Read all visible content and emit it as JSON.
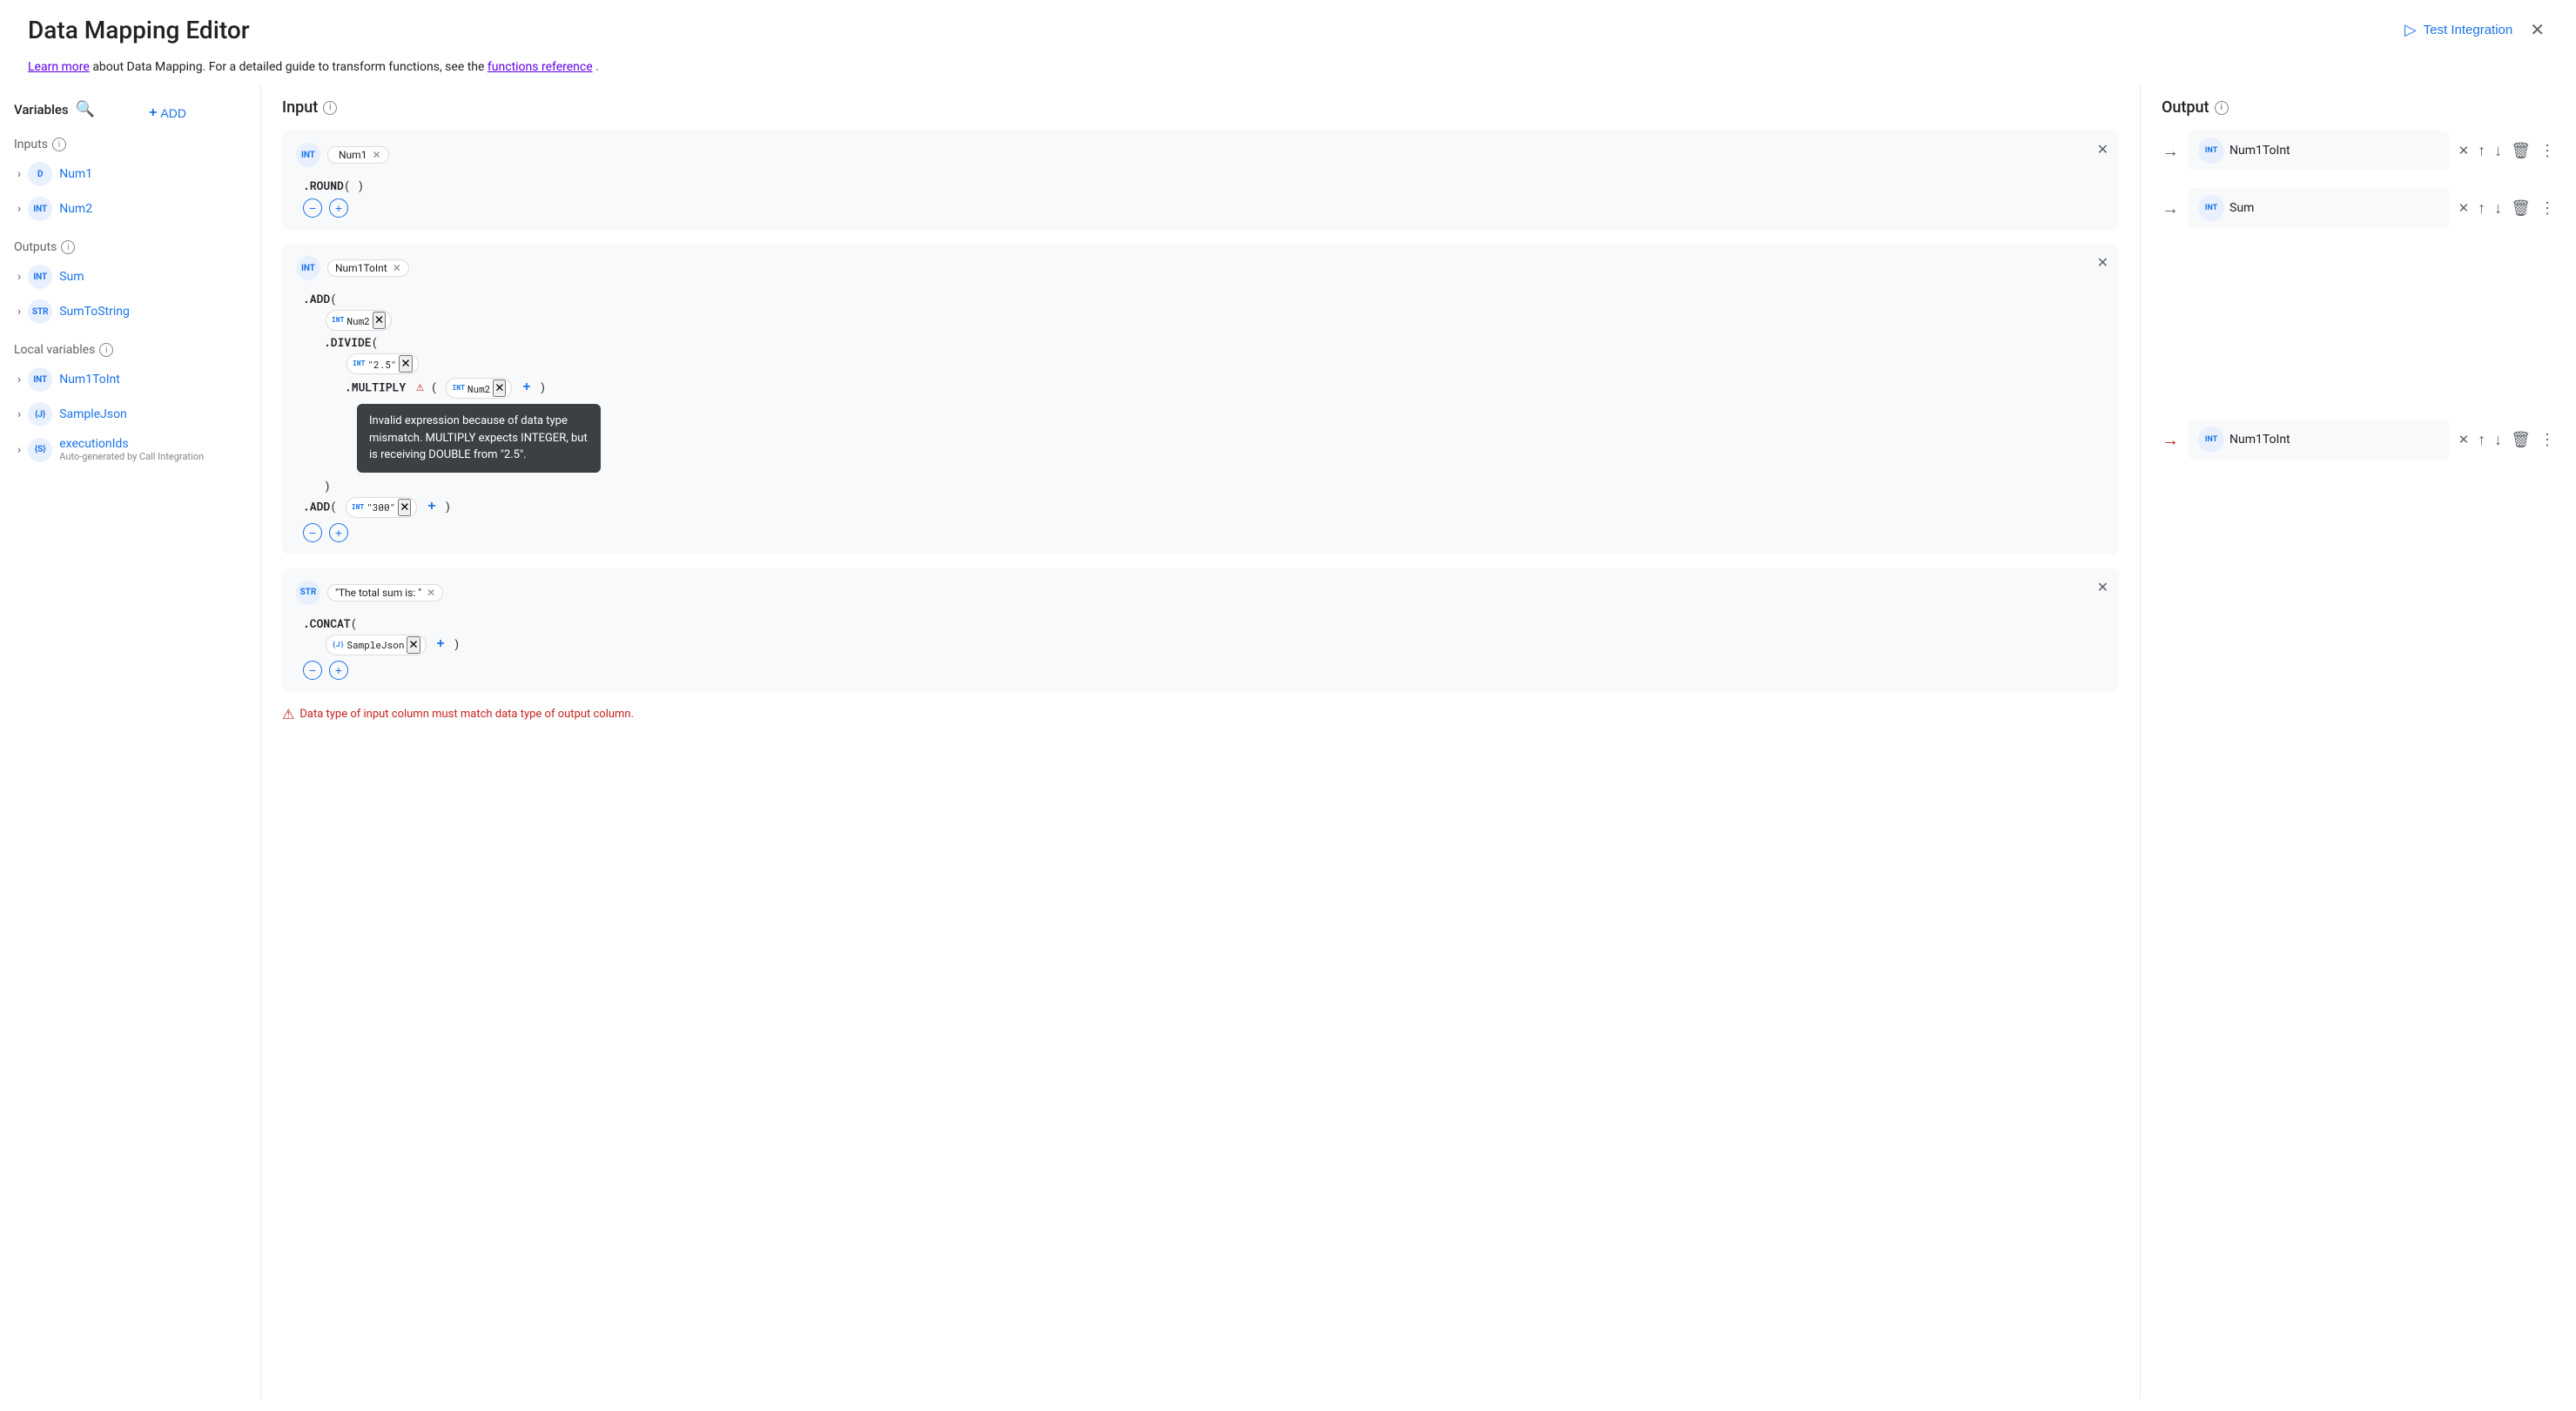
{
  "header": {
    "title": "Data Mapping Editor",
    "test_integration_label": "Test Integration",
    "close_label": "✕"
  },
  "info_bar": {
    "text_before": "Learn more",
    "text_middle": " about Data Mapping. For a detailed guide to transform functions, see the ",
    "link_text": "functions reference",
    "text_after": "."
  },
  "sidebar": {
    "variables_label": "Variables",
    "add_label": "ADD",
    "inputs_label": "Inputs",
    "outputs_label": "Outputs",
    "local_variables_label": "Local variables",
    "inputs": [
      {
        "type": "D",
        "name": "Num1"
      },
      {
        "type": "INT",
        "name": "Num2"
      }
    ],
    "outputs": [
      {
        "type": "INT",
        "name": "Sum"
      },
      {
        "type": "STR",
        "name": "SumToString"
      }
    ],
    "local_variables": [
      {
        "type": "INT",
        "name": "Num1ToInt",
        "subtext": null
      },
      {
        "type": "J",
        "name": "SampleJson",
        "subtext": null
      },
      {
        "type": "S",
        "name": "executionIds",
        "subtext": "Auto-generated by Call Integration"
      }
    ]
  },
  "input_col": {
    "label": "Input",
    "blocks": [
      {
        "id": "block1",
        "var_type": "INT",
        "var_name": "Num1",
        "code_lines": [
          {
            "text": ".ROUND( )",
            "indent": 0
          }
        ],
        "add_minus": true
      },
      {
        "id": "block2",
        "var_type": "INT",
        "var_name": "Num1ToInt",
        "code_lines": [
          {
            "text": ".ADD(",
            "indent": 0
          },
          {
            "text": "",
            "indent": 1,
            "inline_tag": {
              "type": "INT",
              "name": "Num2"
            }
          },
          {
            "text": ".DIVIDE(",
            "indent": 1
          },
          {
            "text": "",
            "indent": 2,
            "inline_tag": {
              "type": "INT",
              "name": "\"2.5\""
            }
          },
          {
            "text": ".MULTIPLY",
            "indent": 2,
            "has_error": true,
            "rest": "( INT Num2 + )"
          },
          {
            "text": "tooltip",
            "is_tooltip": true
          },
          {
            "text": ")",
            "indent": 1
          },
          {
            "text": ".ADD( INT \"300\" × + )",
            "indent": 0
          }
        ],
        "add_minus": true
      },
      {
        "id": "block3",
        "var_type": "STR",
        "var_name": "\"The total sum is: \"",
        "code_lines": [
          {
            "text": ".CONCAT(",
            "indent": 0
          },
          {
            "text": "",
            "indent": 1,
            "inline_tag": {
              "type": "J",
              "name": "SampleJson"
            }
          }
        ],
        "add_minus": true
      }
    ],
    "error_message": "Data type of input column must match data type of output column."
  },
  "output_col": {
    "label": "Output",
    "rows": [
      {
        "arrow": "→",
        "arrow_red": false,
        "type": "INT",
        "name": "Num1ToInt"
      },
      {
        "arrow": "→",
        "arrow_red": false,
        "type": "INT",
        "name": "Sum"
      },
      {
        "arrow": "→",
        "arrow_red": true,
        "type": "INT",
        "name": "Num1ToInt"
      }
    ]
  },
  "tooltip": {
    "text": "Invalid expression because of data type mismatch. MULTIPLY expects INTEGER, but is receiving DOUBLE from \"2.5\"."
  },
  "icons": {
    "search": "🔍",
    "add_plus": "+",
    "info": "i",
    "close": "✕",
    "up_arrow": "↑",
    "down_arrow": "↓",
    "trash": "🗑",
    "more_vert": "⋮",
    "play": "▷",
    "chevron_right": "›",
    "minus": "−",
    "plus": "+"
  }
}
